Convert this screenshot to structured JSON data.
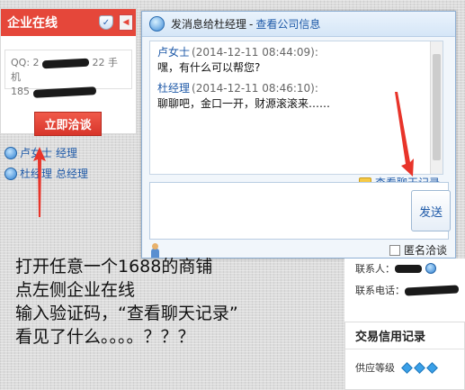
{
  "left_panel": {
    "title": "企业在线",
    "collapse_glyph": "◀",
    "qq_prefix": "QQ: 2",
    "qq_suffix": "22 手机",
    "phone_prefix": "185",
    "consult_label": "立即洽谈",
    "contacts": [
      {
        "name": "卢女士",
        "role": "经理"
      },
      {
        "name": "杜经理",
        "role": "总经理"
      }
    ]
  },
  "chat": {
    "title_to": "发消息给杜经理",
    "title_sep": "-",
    "title_link": "查看公司信息",
    "messages": [
      {
        "sender": "卢女士",
        "time": "(2014-12-11 08:44:09):",
        "body": "嘿，有什么可以帮您?"
      },
      {
        "sender": "杜经理",
        "time": "(2014-12-11 08:46:10):",
        "body": "聊聊吧，金口一开，财源滚滚来……"
      }
    ],
    "history_link": "查看聊天记录",
    "send_label": "发送",
    "anonymous_label": "匿名洽谈"
  },
  "right_page": {
    "contact_person_label": "联系人：",
    "contact_phone_label": "联系电话：",
    "credit_title": "交易信用记录",
    "supplier_level_label": "供应等级"
  },
  "annotation": {
    "line1": "打开任意一个1688的商铺",
    "line2": "点左侧企业在线",
    "line3": "输入验证码，“查看聊天记录”",
    "line4": "看见了什么。。。。？？？"
  },
  "colors": {
    "panel_red": "#e5473a",
    "link_blue": "#1f5aa8",
    "arrow_red": "#e8342a",
    "diamond_blue": "#3aa0e8"
  },
  "icons": {
    "shield": "shield-icon",
    "person": "person-icon",
    "chat_bubble": "chat-bubble-icon",
    "diamond": "diamond-icon"
  }
}
